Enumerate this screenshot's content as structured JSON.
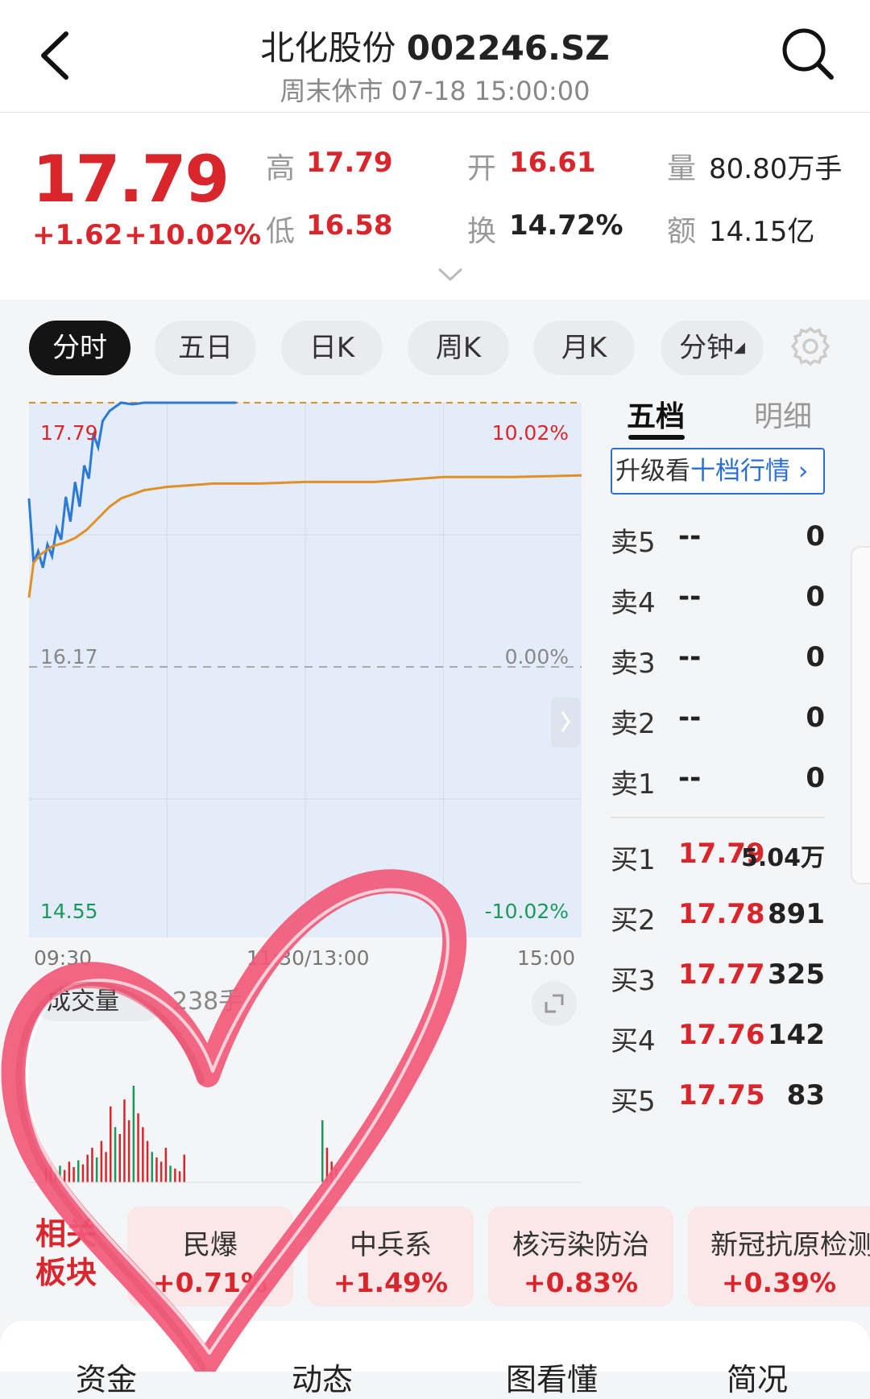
{
  "header": {
    "stock_name": "北化股份",
    "stock_code": "002246.SZ",
    "status": "周末休市 07-18 15:00:00"
  },
  "quote": {
    "price": "17.79",
    "change": "+1.62",
    "change_pct": "+10.02%",
    "high_label": "高",
    "high": "17.79",
    "low_label": "低",
    "low": "16.58",
    "open_label": "开",
    "open": "16.61",
    "turnover_label": "换",
    "turnover": "14.72%",
    "volume_label": "量",
    "volume": "80.80万手",
    "amount_label": "额",
    "amount": "14.15亿"
  },
  "tabs": [
    "分时",
    "五日",
    "日K",
    "周K",
    "月K",
    "分钟"
  ],
  "chart": {
    "top_price": "17.79",
    "top_pct": "10.02%",
    "mid_price": "16.17",
    "mid_pct": "0.00%",
    "bottom_price": "14.55",
    "bottom_pct": "-10.02%",
    "time_start": "09:30",
    "time_mid": "11:30/13:00",
    "time_end": "15:00",
    "volume_label": "成交量",
    "volume_value": "238手"
  },
  "chart_data": {
    "type": "line",
    "title": "",
    "xlabel": "",
    "ylabel": "",
    "x_ticks": [
      "09:30",
      "11:30/13:00",
      "15:00"
    ],
    "ylim": [
      14.55,
      17.79
    ],
    "y_ticks_left": [
      "17.79",
      "16.17",
      "14.55"
    ],
    "y_ticks_right": [
      "10.02%",
      "0.00%",
      "-10.02%"
    ],
    "series": [
      {
        "name": "",
        "color": "#2a7ad6",
        "x": [
          0,
          2,
          4,
          6,
          8,
          10,
          12,
          14,
          16,
          18,
          20,
          22,
          24,
          26,
          28,
          30,
          32,
          35,
          40,
          45,
          50,
          60,
          75,
          90
        ],
        "values": [
          17.21,
          16.82,
          16.89,
          16.79,
          16.93,
          16.86,
          17.03,
          16.96,
          17.22,
          17.07,
          17.31,
          17.16,
          17.41,
          17.33,
          17.6,
          17.52,
          17.68,
          17.74,
          17.79,
          17.78,
          17.79,
          17.79,
          17.79,
          17.79
        ]
      },
      {
        "name": "",
        "color": "#e0902a",
        "x": [
          0,
          2,
          5,
          10,
          15,
          20,
          25,
          30,
          35,
          40,
          50,
          60,
          80,
          100,
          120,
          150,
          180,
          210,
          240
        ],
        "values": [
          16.61,
          16.82,
          16.87,
          16.92,
          16.94,
          16.97,
          17.02,
          17.09,
          17.16,
          17.21,
          17.26,
          17.28,
          17.3,
          17.3,
          17.31,
          17.31,
          17.34,
          17.34,
          17.35
        ]
      }
    ],
    "volume": {
      "type": "bar",
      "unit": "手",
      "x": [
        0,
        2,
        4,
        6,
        8,
        10,
        12,
        14,
        16,
        18,
        20,
        22,
        24,
        26,
        28,
        30,
        32,
        34,
        36,
        38,
        40,
        42,
        44,
        46,
        48,
        50,
        52,
        54,
        56,
        58,
        60,
        120,
        122,
        124,
        126
      ],
      "values": [
        10,
        14,
        8,
        12,
        9,
        15,
        11,
        16,
        13,
        20,
        25,
        18,
        30,
        22,
        55,
        40,
        35,
        60,
        45,
        70,
        50,
        40,
        30,
        22,
        18,
        15,
        25,
        12,
        10,
        8,
        20,
        45,
        25,
        15,
        10
      ]
    }
  },
  "orderbook": {
    "tab_active": "五档",
    "tab_other": "明细",
    "upgrade_prefix": "升级看",
    "upgrade_highlight": "十档行情",
    "asks": [
      {
        "label": "卖5",
        "price": "--",
        "vol": "0"
      },
      {
        "label": "卖4",
        "price": "--",
        "vol": "0"
      },
      {
        "label": "卖3",
        "price": "--",
        "vol": "0"
      },
      {
        "label": "卖2",
        "price": "--",
        "vol": "0"
      },
      {
        "label": "卖1",
        "price": "--",
        "vol": "0"
      }
    ],
    "bids": [
      {
        "label": "买1",
        "price": "17.79",
        "vol": "5.04万"
      },
      {
        "label": "买2",
        "price": "17.78",
        "vol": "891"
      },
      {
        "label": "买3",
        "price": "17.77",
        "vol": "325"
      },
      {
        "label": "买4",
        "price": "17.76",
        "vol": "142"
      },
      {
        "label": "买5",
        "price": "17.75",
        "vol": "83"
      }
    ]
  },
  "sectors": {
    "label_line1": "相关",
    "label_line2": "板块",
    "items": [
      {
        "name": "民爆",
        "pct": "+0.71%"
      },
      {
        "name": "中兵系",
        "pct": "+1.49%"
      },
      {
        "name": "核污染防治",
        "pct": "+0.83%"
      },
      {
        "name": "新冠抗原检测",
        "pct": "+0.39%"
      }
    ]
  },
  "bottom_tabs": [
    "资金",
    "动态",
    "图看懂",
    "简况"
  ],
  "colors": {
    "up": "#d9262c",
    "price_line": "#2a7ad6",
    "avg_line": "#e0902a",
    "heart": "#f25a7a"
  }
}
